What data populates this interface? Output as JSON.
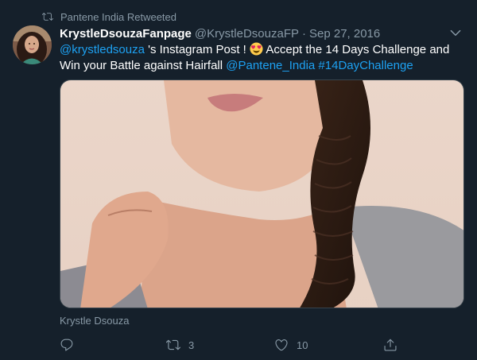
{
  "retweet": {
    "label": "Pantene India Retweeted",
    "icon": "retweet-icon"
  },
  "author": {
    "display_name": "KrystleDsouzaFanpage",
    "handle": "@KrystleDsouzaFP",
    "separator": "·",
    "date": "Sep 27, 2016"
  },
  "tweet": {
    "mention_start": "@krystledsouza",
    "text_part1": " 's Instagram Post ! ",
    "emoji": "heart-eyes-emoji",
    "text_part2": " Accept the 14 Days Challenge and Win your Battle against Hairfall ",
    "mention_brand": "@Pantene_India",
    "hashtag": "#14DayChallenge"
  },
  "media": {
    "caption": "Krystle Dsouza"
  },
  "actions": {
    "reply_count": "",
    "retweet_count": "3",
    "like_count": "10",
    "share_count": ""
  },
  "colors": {
    "background": "#15202b",
    "text": "#ffffff",
    "muted": "#8899a6",
    "link": "#1da1f2"
  }
}
